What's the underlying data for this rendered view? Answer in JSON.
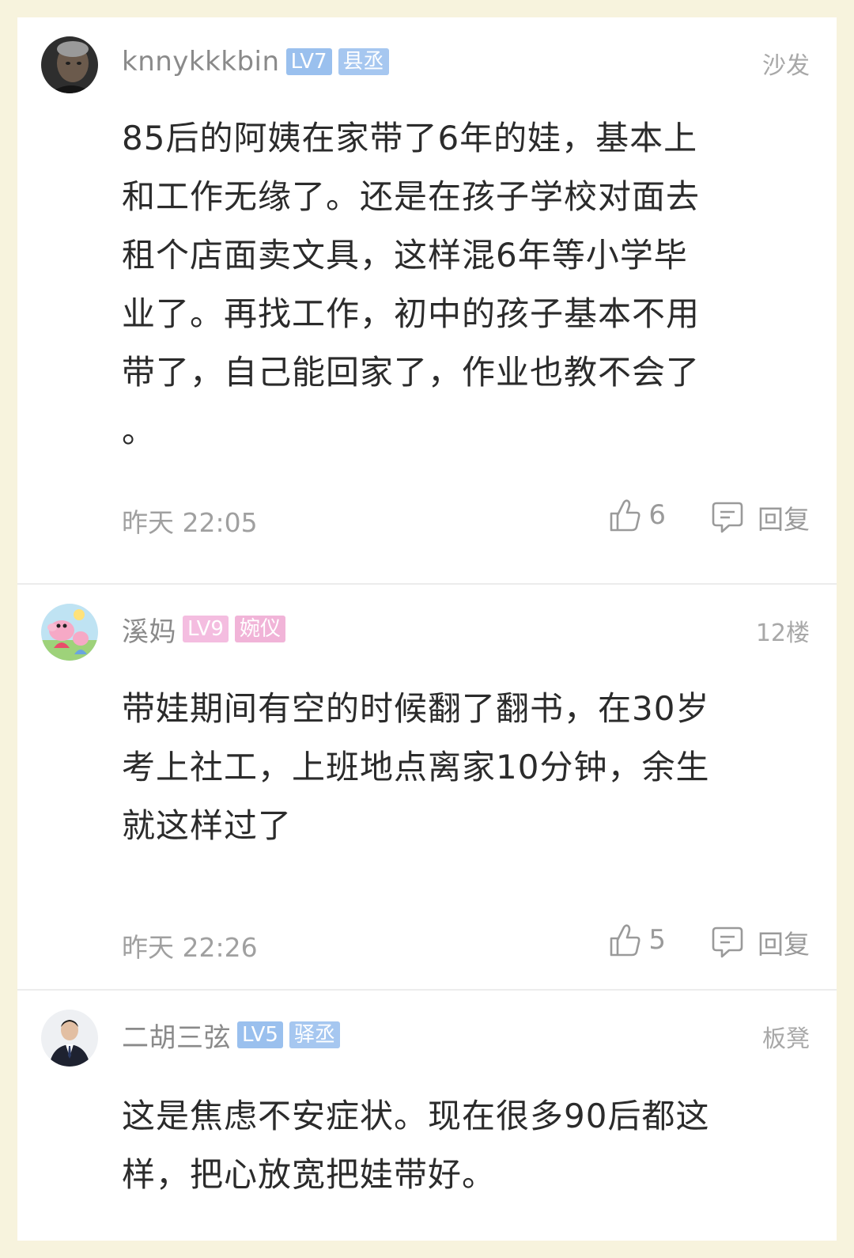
{
  "colors": {
    "background": "#f7f3dd",
    "card": "#ffffff",
    "level_badge_blue": "#9ac0ee",
    "title_badge_blue": "#a6c7f0",
    "level_badge_pink": "#f4bde0",
    "title_badge_pink": "#f1b4d8"
  },
  "comments": [
    {
      "username": "knnykkkbin",
      "level": "LV7",
      "title": "县丞",
      "floor": "沙发",
      "content": "85后的阿姨在家带了6年的娃，基本上\n和工作无缘了。还是在孩子学校对面去\n租个店面卖文具，这样混6年等小学毕\n业了。再找工作，初中的孩子基本不用\n带了，自己能回家了，作业也教不会了\n。",
      "time": "昨天 22:05",
      "likes": "6",
      "reply_label": "回复",
      "avatar_icon": "man-portrait-avatar"
    },
    {
      "username": "溪妈",
      "level": "LV9",
      "title": "婉仪",
      "floor": "12楼",
      "content": "带娃期间有空的时候翻了翻书，在30岁\n考上社工，上班地点离家10分钟，余生\n就这样过了",
      "time": "昨天 22:26",
      "likes": "5",
      "reply_label": "回复",
      "avatar_icon": "peppa-pig-avatar"
    },
    {
      "username": "二胡三弦",
      "level": "LV5",
      "title": "驿丞",
      "floor": "板凳",
      "content": "这是焦虑不安症状。现在很多90后都这\n样，把心放宽把娃带好。",
      "avatar_icon": "man-in-suit-avatar"
    }
  ]
}
